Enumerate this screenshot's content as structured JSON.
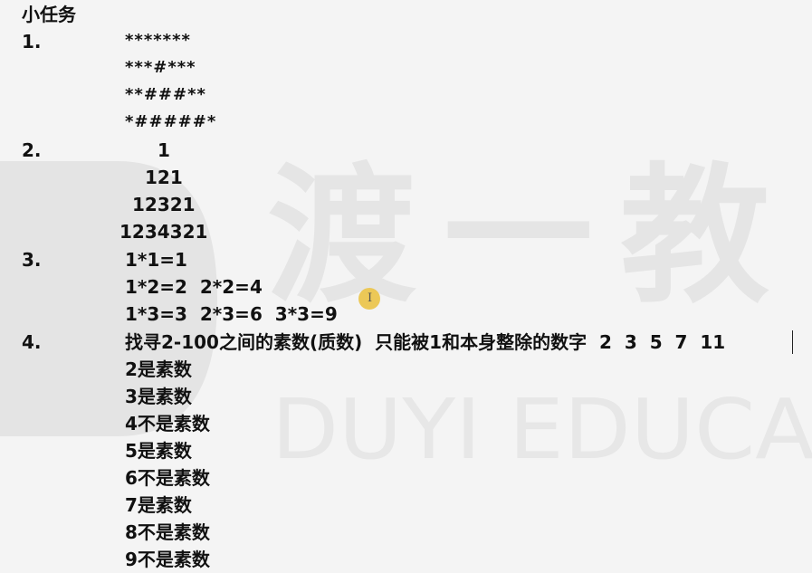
{
  "watermark": {
    "big": "渡一教",
    "latin": "DUYI EDUCA"
  },
  "title": "小任务",
  "tasks": [
    {
      "num": "1.",
      "lines": [
        "*******",
        "***#***",
        "**###**",
        "*#####*"
      ]
    },
    {
      "num": "2.",
      "lines": [
        "1",
        "121",
        "12321",
        "1234321"
      ]
    },
    {
      "num": "3.",
      "lines": [
        "1*1=1",
        "1*2=2  2*2=4",
        "1*3=3  2*3=6  3*3=9"
      ]
    },
    {
      "num": "4.",
      "lines": [
        "找寻2-100之间的素数(质数)  只能被1和本身整除的数字  2  3  5  7  11",
        "2是素数",
        "3是素数",
        "4不是素数",
        "5是素数",
        "6不是素数",
        "7是素数",
        "8不是素数",
        "9不是素数"
      ]
    }
  ],
  "cursor_glyph": "I"
}
